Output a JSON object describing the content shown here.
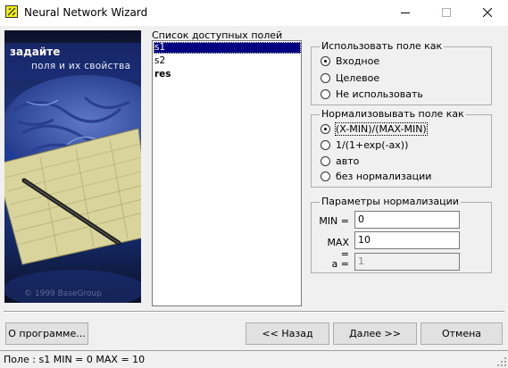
{
  "window": {
    "title": "Neural Network Wizard",
    "icon": "wizard-app-icon",
    "controls": [
      "minimize-icon",
      "maximize-icon",
      "close-icon"
    ]
  },
  "banner": {
    "heading": "задайте",
    "subheading": "поля и их свойства",
    "copyright": "© 1999 BaseGroup"
  },
  "fields_list": {
    "label": "Список доступных полей",
    "items": [
      {
        "label": "s1",
        "selected": true,
        "bold": false
      },
      {
        "label": "s2",
        "selected": false,
        "bold": false
      },
      {
        "label": "res",
        "selected": false,
        "bold": true
      }
    ]
  },
  "use_as": {
    "title": "Использовать поле как",
    "options": [
      {
        "label": "Входное",
        "checked": true
      },
      {
        "label": "Целевое",
        "checked": false
      },
      {
        "label": "Не использовать",
        "checked": false
      }
    ]
  },
  "normalize": {
    "title": "Нормализовывать поле как",
    "options": [
      {
        "label": "(X-MIN)/(MAX-MIN)",
        "checked": true
      },
      {
        "label": "1/(1+exp(-ax))",
        "checked": false
      },
      {
        "label": "авто",
        "checked": false
      },
      {
        "label": "без нормализации",
        "checked": false
      }
    ]
  },
  "params": {
    "title": "Параметры нормализации",
    "min": {
      "label": "MIN =",
      "value": "0"
    },
    "max": {
      "label": "MAX =",
      "value": "10"
    },
    "a": {
      "label": "a =",
      "value": "1"
    }
  },
  "buttons": {
    "about": "О программе...",
    "back": "<< Назад",
    "next": "Далее >>",
    "cancel": "Отмена"
  },
  "status": {
    "text": "Поле : s1  MIN = 0 MAX = 10"
  },
  "colors": {
    "selection": "#000080",
    "banner_dark": "#0b1024",
    "banner_blue": "#1e3d9a",
    "app_icon_yellow": "#f7f300"
  }
}
